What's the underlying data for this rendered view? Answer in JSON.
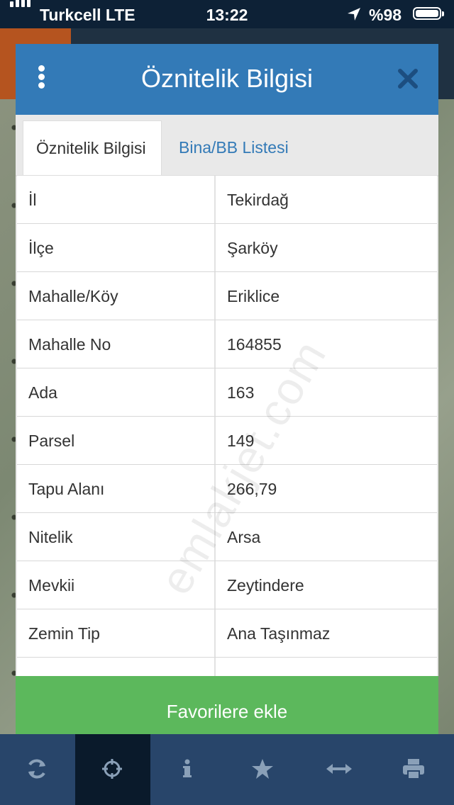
{
  "status_bar": {
    "carrier": "Turkcell  LTE",
    "time": "13:22",
    "battery": "%98"
  },
  "modal": {
    "title": "Öznitelik Bilgisi",
    "tabs": [
      {
        "label": "Öznitelik Bilgisi",
        "active": true
      },
      {
        "label": "Bina/BB Listesi",
        "active": false
      }
    ],
    "rows": [
      {
        "key": "İl",
        "value": "Tekirdağ"
      },
      {
        "key": "İlçe",
        "value": "Şarköy"
      },
      {
        "key": "Mahalle/Köy",
        "value": "Eriklice"
      },
      {
        "key": "Mahalle No",
        "value": "164855"
      },
      {
        "key": "Ada",
        "value": "163"
      },
      {
        "key": "Parsel",
        "value": "149"
      },
      {
        "key": "Tapu Alanı",
        "value": "266,79"
      },
      {
        "key": "Nitelik",
        "value": "Arsa"
      },
      {
        "key": "Mevkii",
        "value": "Zeytindere"
      },
      {
        "key": "Zemin Tip",
        "value": "Ana Taşınmaz"
      }
    ],
    "favorite_button": "Favorilere ekle"
  },
  "watermark": "emlakjet.com",
  "toolbar": {
    "icons": [
      "refresh-icon",
      "crosshair-icon",
      "info-icon",
      "star-icon",
      "measure-icon",
      "print-icon"
    ],
    "active_index": 1
  },
  "colors": {
    "header": "#337ab7",
    "button": "#5cb85c",
    "toolbar": "#28456a",
    "status_bar": "#0d2136"
  }
}
